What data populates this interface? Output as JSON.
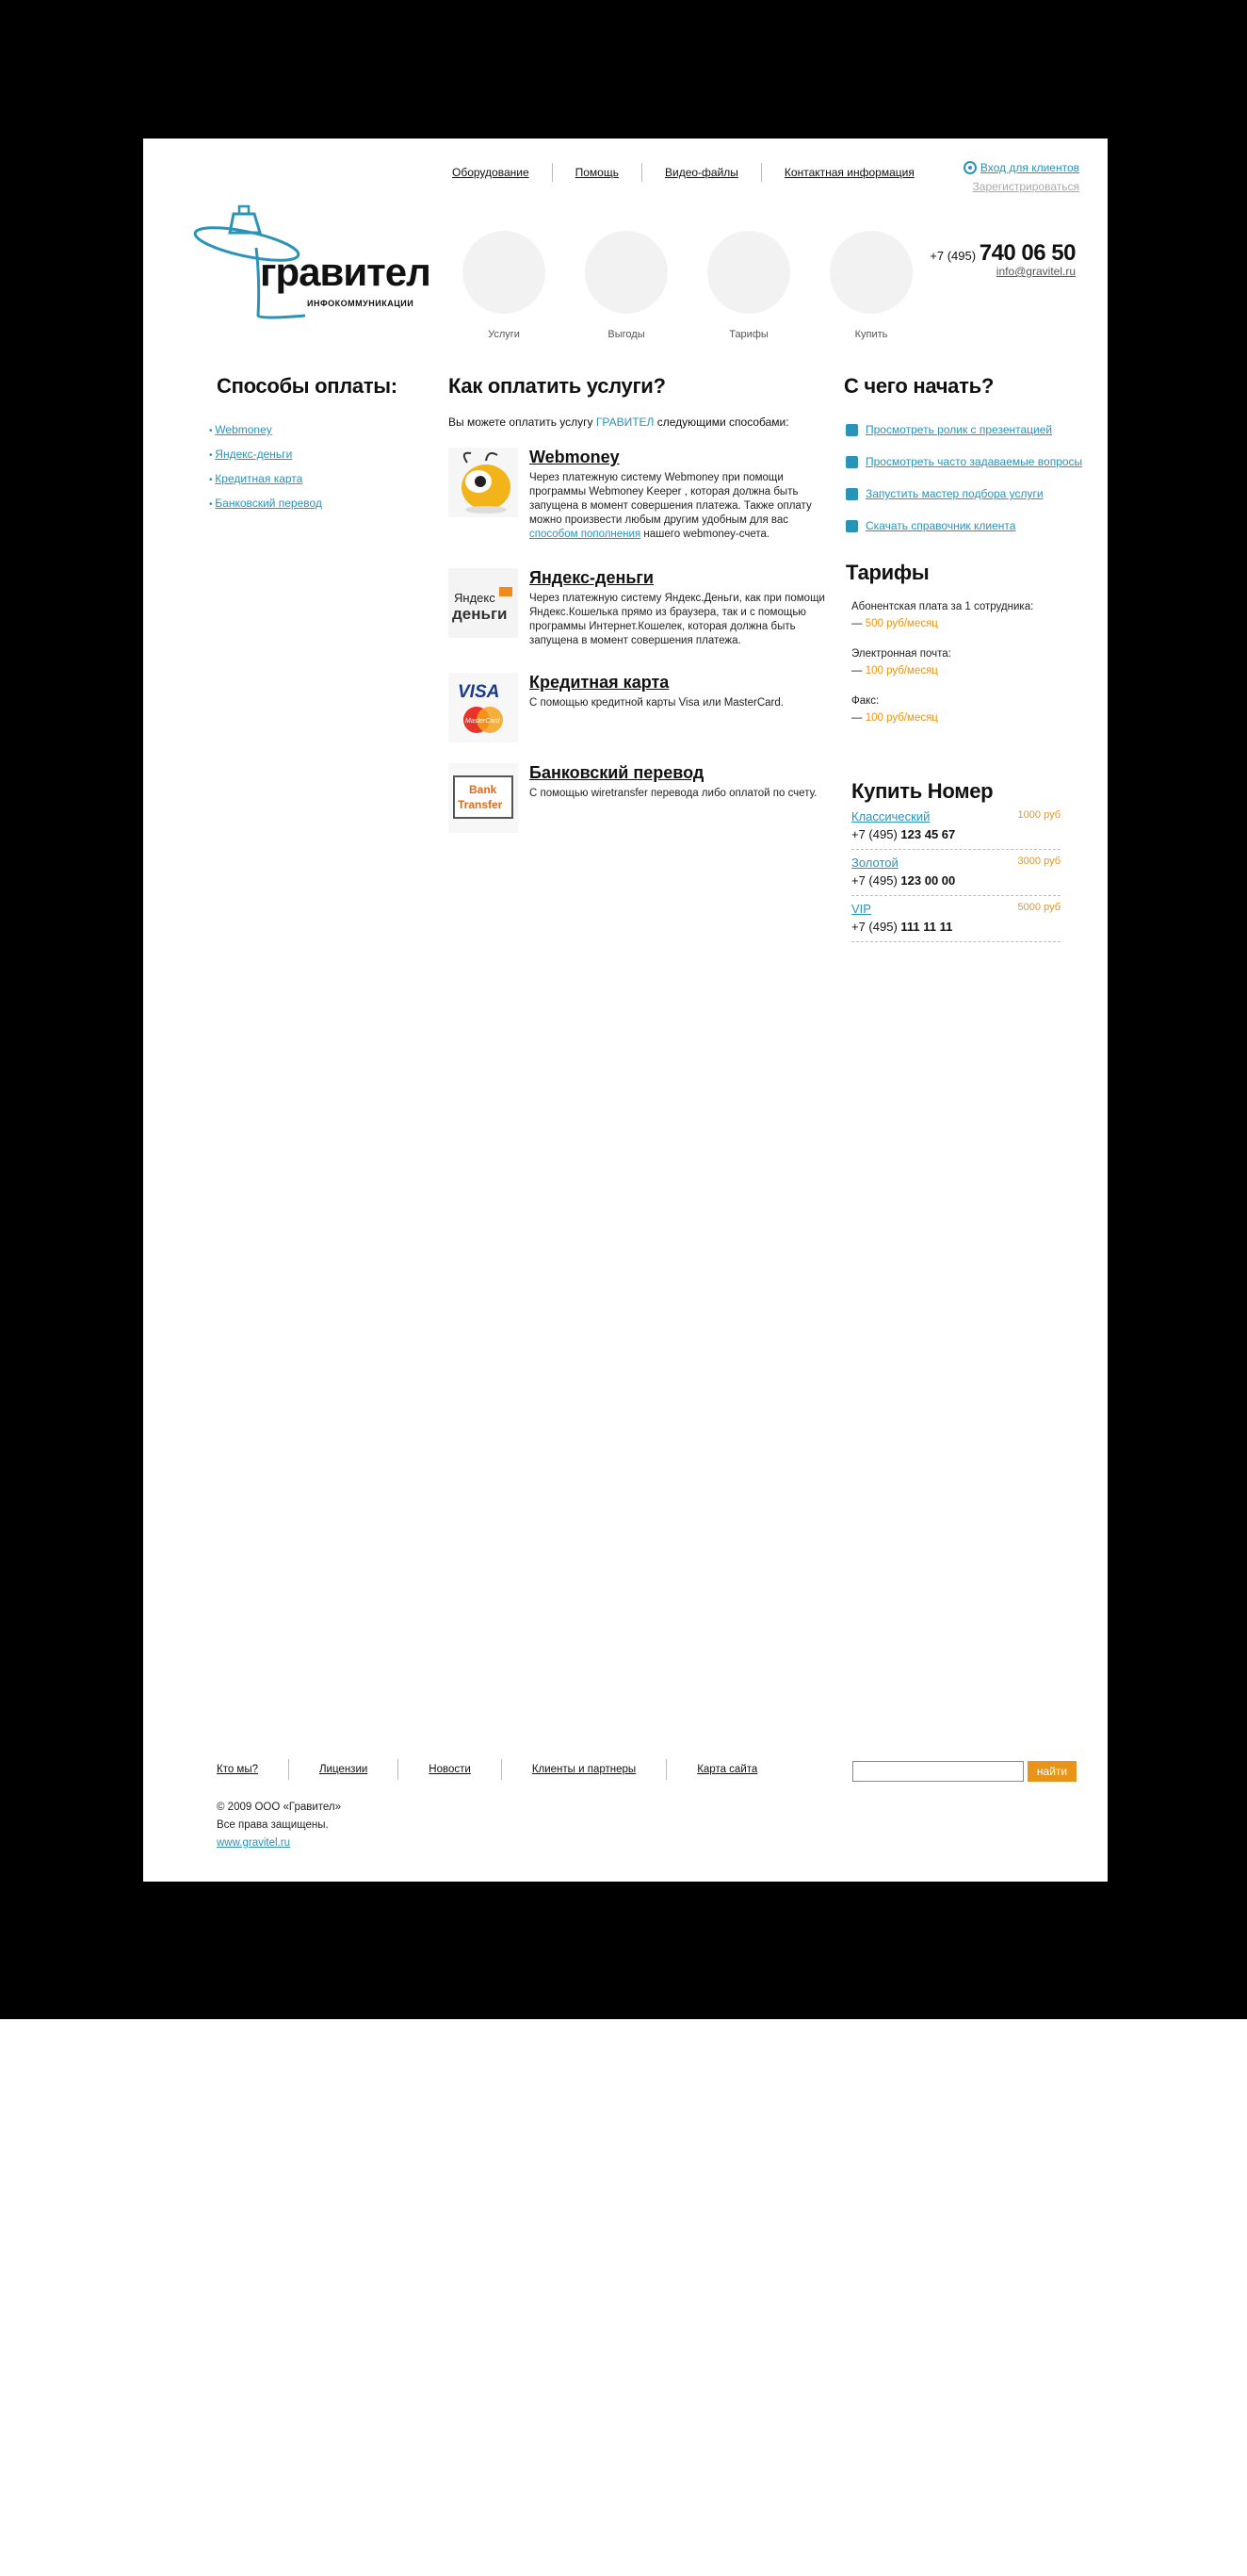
{
  "nav": [
    "Оборудование",
    "Помощь",
    "Видео-файлы",
    "Контактная информация"
  ],
  "login": {
    "enter": "Вход для клиентов",
    "register": "Зарегистрироваться"
  },
  "logo": {
    "brand": "гравител",
    "sub": "ИНФОКОММУНИКАЦИИ"
  },
  "circles": [
    "Услуги",
    "Выгоды",
    "Тарифы",
    "Купить"
  ],
  "phone": {
    "prefix": "+7 (495)",
    "number": "740 06 50",
    "email": "info@gravitel.ru"
  },
  "left": {
    "title": "Способы оплаты:",
    "items": [
      "Webmoney",
      "Яндекс-деньги",
      "Кредитная карта",
      "Банковский перевод"
    ]
  },
  "center": {
    "title": "Как оплатить услуги?",
    "intro_before": "Вы можете оплатить услугу ",
    "intro_brand": "ГРАВИТЕЛ",
    "intro_after": " следующими способами:",
    "methods": [
      {
        "title": "Webmoney",
        "text": "Через платежную систему Webmoney при помощи программы Webmoney Keeper , которая должна быть запущена в момент совершения платежа. Также оплату можно произвести любым другим удобным для вас ",
        "link": "способом пополнения",
        "text2": " нашего webmoney-счета."
      },
      {
        "title": "Яндекс-деньги",
        "text": "Через платежную систему Яндекс.Деньги, как при помощи Яндекс.Кошелька прямо из браузера, так и с помощью программы Интернет.Кошелек, которая должна быть запущена в момент совершения платежа."
      },
      {
        "title": "Кредитная карта",
        "text": "С помощью кредитной карты Visa или MasterCard."
      },
      {
        "title": "Банковский перевод",
        "text": "С помощью wiretransfer перевода либо оплатой по счету."
      }
    ],
    "img_labels": {
      "yandex1": "Яндекс",
      "yandex2": "деньги",
      "visa": "VISA",
      "mc": "MasterCard",
      "bank1": "Bank",
      "bank2": "Transfer"
    }
  },
  "right": {
    "title": "С чего начать?",
    "actions": [
      "Просмотреть ролик с презентацией",
      "Просмотреть часто задаваемые вопросы",
      "Запустить мастер подбора услуги",
      "Скачать справочник клиента"
    ],
    "tariffs_title": "Тарифы",
    "tariffs": [
      {
        "label": "Абонентская плата за 1 сотрудника:",
        "price": "500 руб/месяц"
      },
      {
        "label": "Электронная почта:",
        "price": "100 руб/месяц"
      },
      {
        "label": "Факс:",
        "price": "100 руб/месяц"
      }
    ],
    "dash": "— ",
    "buy_title": "Купить Номер",
    "numbers": [
      {
        "name": "Классический",
        "price": "1000 руб",
        "prefix": "+7 (495) ",
        "num": "123 45 67"
      },
      {
        "name": "Золотой",
        "price": "3000 руб",
        "prefix": "+7 (495) ",
        "num": "123 00 00"
      },
      {
        "name": "VIP",
        "price": "5000 руб",
        "prefix": "+7 (495) ",
        "num": "111 11 11"
      }
    ]
  },
  "footer": {
    "nav": [
      "Кто мы?",
      "Лицензии",
      "Новости",
      "Клиенты и партнеры",
      "Карта сайта"
    ],
    "search_button": "найти",
    "copyright": "© 2009 ООО «Гравител»",
    "rights": "Все права защищены.",
    "site": "www.gravitel.ru"
  },
  "colors": {
    "accent": "#2a93b8",
    "orange": "#e8941a"
  }
}
